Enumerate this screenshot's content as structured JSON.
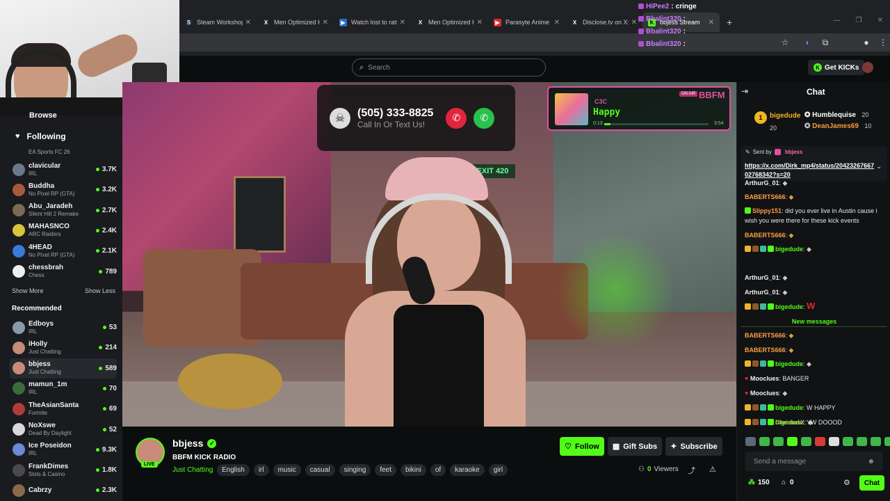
{
  "browser": {
    "tabs": [
      {
        "label": "Steam Workshop::",
        "icon": "steam-icon"
      },
      {
        "label": "Men Optimized H",
        "icon": "x-icon"
      },
      {
        "label": "Watch lost to rats",
        "icon": "video-icon"
      },
      {
        "label": "Men Optimized H",
        "icon": "x-icon"
      },
      {
        "label": "Parasyte Anime O",
        "icon": "youtube-icon"
      },
      {
        "label": "Disclose.tv on X:",
        "icon": "x-icon"
      },
      {
        "label": "bbjess Stream",
        "icon": "kick-icon",
        "active": true
      }
    ],
    "new_tab": "+"
  },
  "stream_overlay_chat": [
    {
      "user": "HiPee2",
      "msg": "cringe",
      "color": "#c77dff"
    },
    {
      "user": "Bbalint320",
      "msg": "",
      "color": "#c77dff"
    },
    {
      "user": "Bbalint320",
      "msg": "",
      "color": "#c77dff"
    },
    {
      "user": "Bbalint320",
      "msg": "",
      "color": "#c77dff"
    }
  ],
  "header": {
    "search_placeholder": "Search",
    "get_kicks": "Get KICKs"
  },
  "sidebar": {
    "browse": "Browse",
    "following_title": "Following",
    "following_sub": "EA Sports FC 26",
    "following": [
      {
        "name": "clavicular",
        "game": "IRL",
        "viewers": "3.7K",
        "color": "#6a7a8a"
      },
      {
        "name": "Buddha",
        "game": "No Pixel RP (GTA)",
        "viewers": "3.2K",
        "color": "#a85b3a"
      },
      {
        "name": "Abu_Jaradeh",
        "game": "Silent Hill 2 Remake",
        "viewers": "2.7K",
        "color": "#7b6a55"
      },
      {
        "name": "MAHASNCO",
        "game": "ARC Raiders",
        "viewers": "2.4K",
        "color": "#d9c43a"
      },
      {
        "name": "4HEAD",
        "game": "No Pixel RP (GTA)",
        "viewers": "2.1K",
        "color": "#3a7bd9"
      },
      {
        "name": "chessbrah",
        "game": "Chess",
        "viewers": "789",
        "color": "#eeeeee"
      }
    ],
    "show_more": "Show More",
    "show_less": "Show Less",
    "recommended_title": "Recommended",
    "recommended": [
      {
        "name": "Edboys",
        "game": "IRL",
        "viewers": "53",
        "color": "#8899aa"
      },
      {
        "name": "iHolly",
        "game": "Just Chatting",
        "viewers": "214",
        "color": "#c48a7a"
      },
      {
        "name": "bbjess",
        "game": "Just Chatting",
        "viewers": "589",
        "color": "#c98b7a",
        "active": true
      },
      {
        "name": "mamun_1m",
        "game": "IRL",
        "viewers": "70",
        "color": "#3b6b3b"
      },
      {
        "name": "TheAsianSanta",
        "game": "Fortnite",
        "viewers": "69",
        "color": "#b23b3b"
      },
      {
        "name": "NoXswe",
        "game": "Dead By Daylight",
        "viewers": "52",
        "color": "#d8d8d8"
      },
      {
        "name": "Ice Poseidon",
        "game": "IRL",
        "viewers": "9.3K",
        "color": "#6a8ad9"
      },
      {
        "name": "FrankDimes",
        "game": "Slots & Casino",
        "viewers": "1.8K",
        "color": "#4a4a4a"
      },
      {
        "name": "Cabrzy",
        "game": "",
        "viewers": "2.3K",
        "color": "#8a6a4a"
      }
    ]
  },
  "video": {
    "exit_sign": "EXIT 420",
    "call_number": "(505) 333-8825",
    "call_sub": "Call In Or Text Us!",
    "now_playing": {
      "artist": "C3C",
      "title": "Happy",
      "on_air": "ON AIR",
      "brand": "BBFM",
      "time_start": "0:13",
      "time_end": "3:54",
      "progress": 0.06
    }
  },
  "stream": {
    "name": "bbjess",
    "live": "LIVE",
    "title": "BBFM KICK RADIO",
    "category": "Just Chatting",
    "tags": [
      "English",
      "irl",
      "music",
      "casual",
      "singing",
      "feet",
      "bikini",
      "of",
      "karaoke",
      "girl"
    ],
    "follow": "Follow",
    "gift_subs": "Gift Subs",
    "subscribe": "Subscribe",
    "viewers_num": "0",
    "viewers_label": "Viewers"
  },
  "chat": {
    "title": "Chat",
    "leaderboard": [
      {
        "name": "bigedude",
        "value": "20",
        "color": "#f1b524"
      },
      {
        "name": "Humblequise",
        "value": "20",
        "color": "#ffffff"
      },
      {
        "name": "DeanJames69",
        "value": "10",
        "color": "#f39c3d"
      }
    ],
    "pinned_sent_by": "Sent by",
    "pinned_user": "bbjess",
    "pinned_link": "https://x.com/Dirk_mp4/status/2042326766702768342?s=20",
    "messages": [
      {
        "user": "ArthurG_01",
        "msg": "",
        "color": "#f1f1f1"
      },
      {
        "user": "BABERTS666",
        "msg": "",
        "color": "#ff9f43"
      },
      {
        "user": "Slippy151",
        "msg": "did you ever live in Austin cause i wish you were there for these kick events",
        "color": "#ff9f43"
      },
      {
        "user": "BABERTS666",
        "msg": "",
        "color": "#ff9f43"
      },
      {
        "user": "bigedude",
        "msg": "",
        "color": "#53fc18"
      },
      {
        "user": "ArthurG_01",
        "msg": "",
        "color": "#f1f1f1"
      },
      {
        "user": "ArthurG_01",
        "msg": "",
        "color": "#f1f1f1"
      },
      {
        "user": "bigedude",
        "msg": "W",
        "color": "#53fc18"
      },
      {
        "user": "BABERTS666",
        "msg": "",
        "color": "#ff9f43"
      },
      {
        "user": "BABERTS666",
        "msg": "",
        "color": "#ff9f43"
      },
      {
        "user": "bigedude",
        "msg": "",
        "color": "#53fc18"
      },
      {
        "user": "Mooclues",
        "msg": "BANGER",
        "color": "#f1f1f1"
      },
      {
        "user": "Mooclues",
        "msg": "",
        "color": "#f1f1f1"
      },
      {
        "user": "bigedude",
        "msg": "W HAPPY",
        "color": "#53fc18"
      },
      {
        "user": "ChrisiusX",
        "msg": "",
        "color": "#ff6b9d"
      },
      {
        "user": "bigedude",
        "msg": "YW DOOOD",
        "color": "#53fc18"
      }
    ],
    "new_messages": "New messages",
    "input_placeholder": "Send a message",
    "kicks": "150",
    "drops": "0",
    "send": "Chat"
  }
}
